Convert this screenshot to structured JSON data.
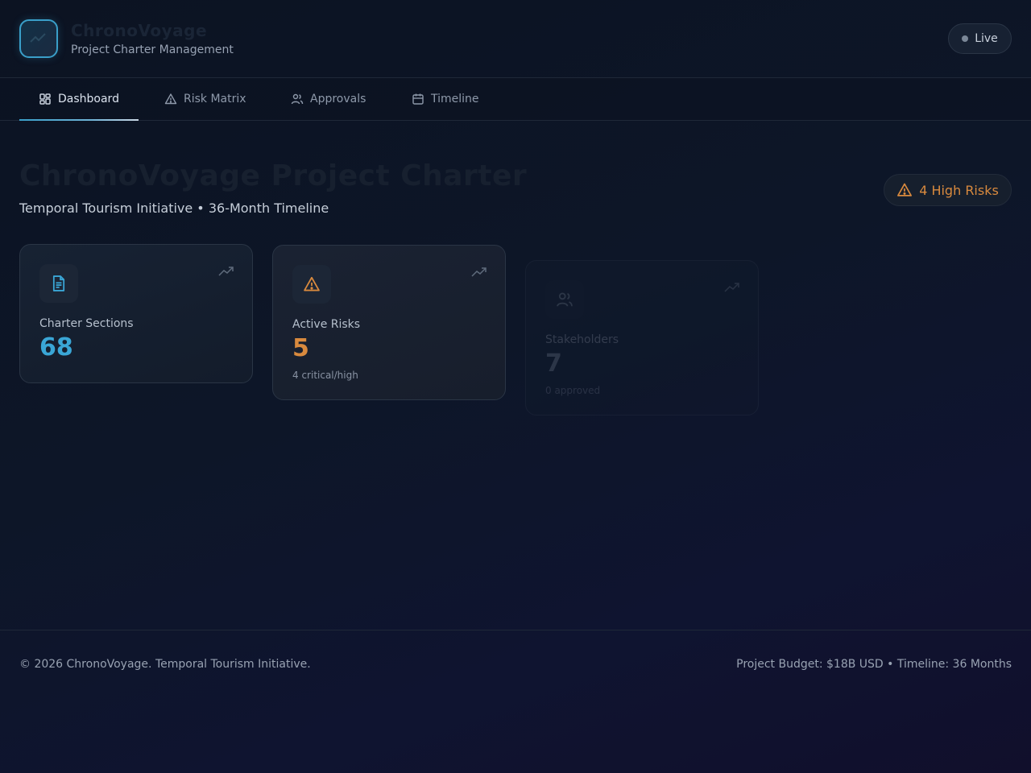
{
  "header": {
    "brand_title": "ChronoVoyage",
    "brand_subtitle": "Project Charter Management",
    "live_label": "Live"
  },
  "nav": {
    "tabs": [
      {
        "label": "Dashboard",
        "icon": "dashboard-grid-icon",
        "active": true
      },
      {
        "label": "Risk Matrix",
        "icon": "warning-triangle-icon",
        "active": false
      },
      {
        "label": "Approvals",
        "icon": "users-icon",
        "active": false
      },
      {
        "label": "Timeline",
        "icon": "calendar-icon",
        "active": false
      }
    ]
  },
  "main": {
    "title": "ChronoVoyage Project Charter",
    "subtitle": "Temporal Tourism Initiative • 36-Month Timeline",
    "risk_badge": "4 High Risks",
    "cards": [
      {
        "label": "Charter Sections",
        "value": "68",
        "note": "",
        "icon": "document-icon",
        "color": "#3aa6d6"
      },
      {
        "label": "Active Risks",
        "value": "5",
        "note": "4 critical/high",
        "icon": "warning-triangle-icon",
        "color": "#d98a3e"
      },
      {
        "label": "Stakeholders",
        "value": "7",
        "note": "0 approved",
        "icon": "users-icon",
        "color": "#9aa6b6"
      }
    ]
  },
  "footer": {
    "copyright": "© 2026 ChronoVoyage. Temporal Tourism Initiative.",
    "budget": "Project Budget: $18B USD • Timeline: 36 Months"
  },
  "colors": {
    "accent": "#3aa6d6",
    "warning": "#d98a3e",
    "background": "#0d1628"
  }
}
